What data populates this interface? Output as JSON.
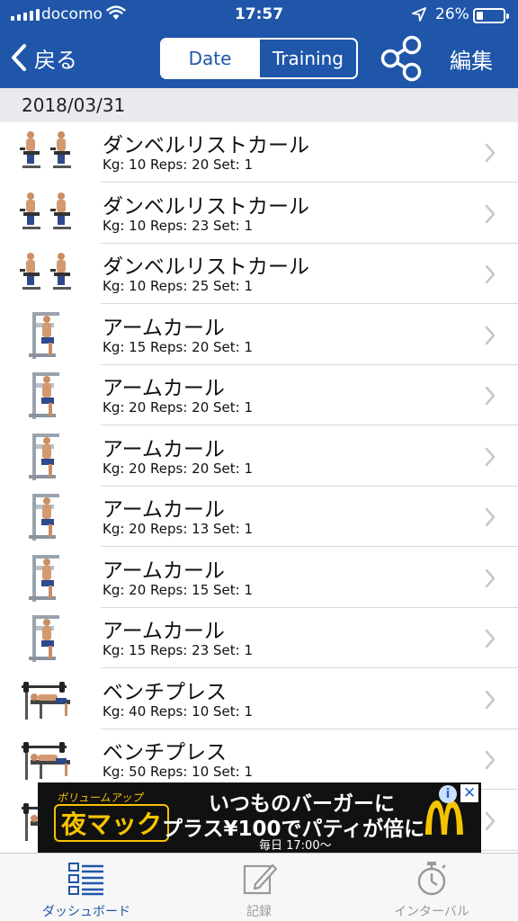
{
  "status_bar": {
    "carrier": "docomo",
    "time": "17:57",
    "battery_percent": "26%",
    "battery_level": 0.26
  },
  "nav": {
    "back_label": "戻る",
    "segments": [
      "Date",
      "Training"
    ],
    "active_segment": "Date",
    "edit_label": "編集",
    "share_icon": "share-icon"
  },
  "section_date": "2018/03/31",
  "entries": [
    {
      "name": "ダンベルリストカール",
      "detail": "Kg: 10 Reps: 20 Set: 1",
      "thumb": "seated-wrist-curl"
    },
    {
      "name": "ダンベルリストカール",
      "detail": "Kg: 10 Reps: 23 Set: 1",
      "thumb": "seated-wrist-curl"
    },
    {
      "name": "ダンベルリストカール",
      "detail": "Kg: 10 Reps: 25 Set: 1",
      "thumb": "seated-wrist-curl"
    },
    {
      "name": "アームカール",
      "detail": "Kg: 15 Reps: 20 Set: 1",
      "thumb": "arm-curl-machine"
    },
    {
      "name": "アームカール",
      "detail": "Kg: 20 Reps: 20 Set: 1",
      "thumb": "arm-curl-machine"
    },
    {
      "name": "アームカール",
      "detail": "Kg: 20 Reps: 20 Set: 1",
      "thumb": "arm-curl-machine"
    },
    {
      "name": "アームカール",
      "detail": "Kg: 20 Reps: 13 Set: 1",
      "thumb": "arm-curl-machine"
    },
    {
      "name": "アームカール",
      "detail": "Kg: 20 Reps: 15 Set: 1",
      "thumb": "arm-curl-machine"
    },
    {
      "name": "アームカール",
      "detail": "Kg: 15 Reps: 23 Set: 1",
      "thumb": "arm-curl-machine"
    },
    {
      "name": "ベンチプレス",
      "detail": "Kg: 40 Reps: 10 Set: 1",
      "thumb": "bench-press"
    },
    {
      "name": "ベンチプレス",
      "detail": "Kg: 50 Reps: 10 Set: 1",
      "thumb": "bench-press"
    },
    {
      "name": "",
      "detail": "",
      "thumb": "bench-press"
    }
  ],
  "ad": {
    "category": "ボリュームアップ",
    "brand": "夜マック",
    "line1": "いつものバーガーに",
    "line2": "プラス¥100でパティが倍に",
    "line3": "毎日 17:00〜",
    "info": "i",
    "close": "✕"
  },
  "tabbar": {
    "items": [
      {
        "label": "ダッシュボード",
        "icon": "dashboard-icon",
        "active": true
      },
      {
        "label": "記録",
        "icon": "edit-record-icon",
        "active": false
      },
      {
        "label": "インターバル",
        "icon": "stopwatch-icon",
        "active": false
      }
    ]
  },
  "colors": {
    "nav_blue": "#1f56a9",
    "section_bg": "#e9e9ee",
    "chevron": "#c7c7cc",
    "tab_inactive": "#999999",
    "ad_gold": "#f5c400",
    "mcd_red": "#da291c"
  }
}
